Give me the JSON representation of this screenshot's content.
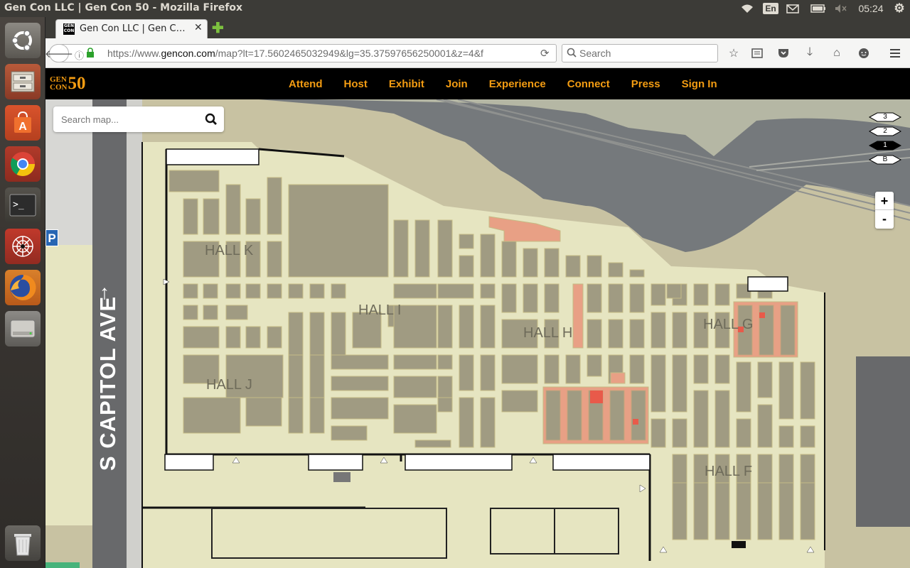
{
  "system": {
    "window_title": "Gen Con LLC | Gen Con 50 - Mozilla Firefox",
    "keyboard_layout": "En",
    "clock": "05:24"
  },
  "launcher": {
    "items": [
      {
        "name": "ubuntu-dash",
        "icon": "ubuntu-logo-icon"
      },
      {
        "name": "files",
        "icon": "file-cabinet-icon"
      },
      {
        "name": "software-center",
        "icon": "shopping-bag-icon"
      },
      {
        "name": "chrome",
        "icon": "chrome-icon"
      },
      {
        "name": "terminal",
        "icon": "terminal-icon"
      },
      {
        "name": "network-app",
        "icon": "spider-web-icon"
      },
      {
        "name": "firefox",
        "icon": "firefox-icon"
      },
      {
        "name": "disk",
        "icon": "disk-drive-icon"
      },
      {
        "name": "trash",
        "icon": "trash-icon"
      }
    ]
  },
  "browser": {
    "tab_title": "Gen Con LLC | Gen C…",
    "url": "https://www.gencon.com/map?lt=17.5602465032949&lg=35.37597656250001&z=4&f…",
    "url_domain": "gencon.com",
    "url_prefix": "https://www.",
    "url_suffix": "/map?lt=17.5602465032949&lg=35.37597656250001&z=4&f",
    "search_placeholder": "Search"
  },
  "site": {
    "logo_text_gen": "GEN",
    "logo_text_con": "CON",
    "logo_number": "50",
    "nav": [
      "Attend",
      "Host",
      "Exhibit",
      "Join",
      "Experience",
      "Connect",
      "Press",
      "Sign In"
    ],
    "accent": "#f39c12"
  },
  "map": {
    "search_placeholder": "Search map...",
    "levels": [
      "3",
      "2",
      "1",
      "B"
    ],
    "active_level": "1",
    "zoom_in": "+",
    "zoom_out": "-",
    "street_label": "S CAPITOL AVE",
    "parking_label": "P",
    "halls": [
      "HALL K",
      "HALL I",
      "HALL H",
      "HALL G",
      "HALL J",
      "HALL F"
    ],
    "colors": {
      "floor": "#e6e5c1",
      "booth": "#a09b82",
      "highlight": "#e8a085",
      "water": "#75797c",
      "street": "#68696b",
      "outside": "#c8c2a2"
    }
  }
}
